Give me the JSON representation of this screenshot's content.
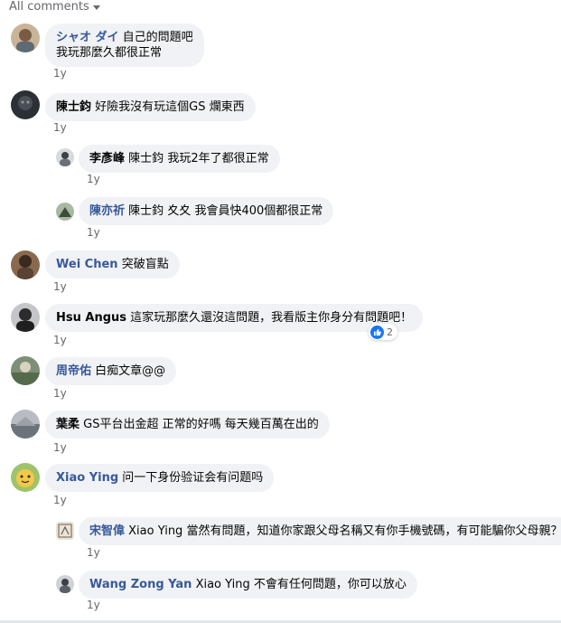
{
  "filter": {
    "label": "All comments"
  },
  "comments": [
    {
      "author": "シャオ ダイ",
      "text_line1": "自己的問題吧",
      "text_line2": "我玩那麼久都很正常",
      "time": "1y"
    },
    {
      "author": "陳士鈞",
      "text": "好險我沒有玩這個GS 爛東西",
      "time": "1y",
      "replies": [
        {
          "author": "李彥峰",
          "tag": "陳士鈞",
          "text": "我玩2年了都很正常",
          "time": "1y"
        },
        {
          "author": "陳亦祈",
          "tag": "陳士鈞",
          "text": "夊夊 我會員快400個都很正常",
          "time": "1y"
        }
      ]
    },
    {
      "author": "Wei Chen",
      "text": "突破盲點",
      "time": "1y"
    },
    {
      "author": "Hsu Angus",
      "text": "這家玩那麼久還沒這問題，我看版主你身分有問題吧！",
      "time": "1y",
      "likes": "2"
    },
    {
      "author": "周帝佑",
      "text": "白痴文章@@",
      "time": "1y"
    },
    {
      "author": "葉柔",
      "text": "GS平台出金超 正常的好嗎 每天幾百萬在出的",
      "time": "1y"
    },
    {
      "author": "Xiao Ying",
      "text": "问一下身份验证会有问题吗",
      "time": "1y",
      "replies": [
        {
          "author": "宋智偉",
          "tag": "Xiao Ying",
          "text": "當然有問題，知道你家跟父母名稱又有你手機號碼，有可能騙你父母親？",
          "time": "1y"
        },
        {
          "author": "Wang Zong Yan",
          "tag": "Xiao Ying",
          "text": "不會有任何問題，你可以放心",
          "time": "1y"
        }
      ]
    }
  ],
  "colors": {
    "link": "#385898",
    "bubble": "#f0f2f5",
    "meta": "#65676b",
    "like": "#1877f2"
  }
}
